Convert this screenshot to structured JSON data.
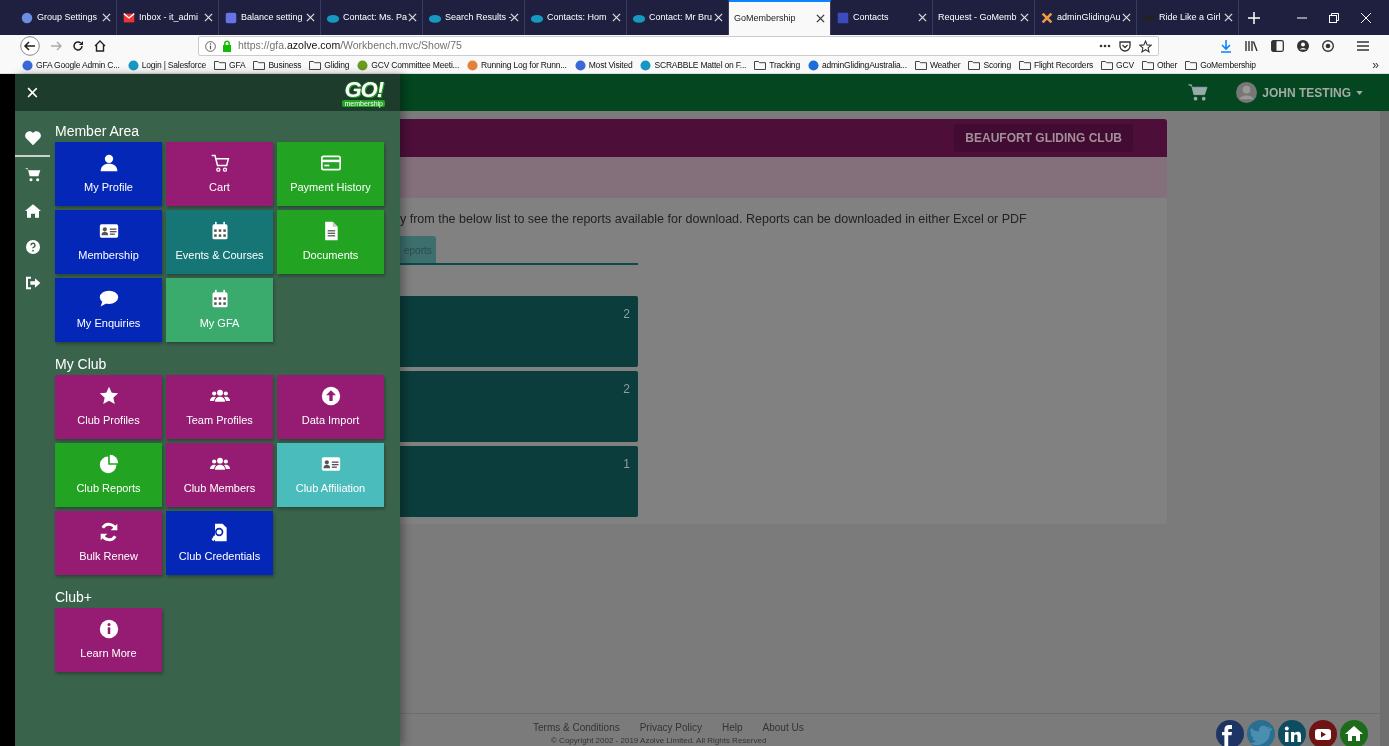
{
  "browser": {
    "tabs": [
      {
        "title": "Group Settings",
        "selected": false
      },
      {
        "title": "Inbox - it_admi",
        "selected": false
      },
      {
        "title": "Balance setting",
        "selected": false
      },
      {
        "title": "Contact: Ms. Pa",
        "selected": false
      },
      {
        "title": "Search Results -",
        "selected": false
      },
      {
        "title": "Contacts: Hom",
        "selected": false
      },
      {
        "title": "Contact: Mr Bru",
        "selected": false
      },
      {
        "title": "GoMembership",
        "selected": true
      },
      {
        "title": "Contacts",
        "selected": false
      },
      {
        "title": "Request - GoMemb",
        "selected": false
      },
      {
        "title": "adminGlidingAu",
        "selected": false
      },
      {
        "title": "Ride Like a Girl",
        "selected": false
      }
    ],
    "url_prefix": "https://gfa.",
    "url_domain": "azolve.com",
    "url_path": "/Workbench.mvc/Show/75",
    "bookmarks": [
      {
        "label": "GFA Google Admin C...",
        "kind": "site"
      },
      {
        "label": "Login | Salesforce",
        "kind": "site"
      },
      {
        "label": "GFA",
        "kind": "folder"
      },
      {
        "label": "Business",
        "kind": "folder"
      },
      {
        "label": "Gliding",
        "kind": "folder"
      },
      {
        "label": "GCV Committee Meeti...",
        "kind": "site"
      },
      {
        "label": "Running Log for Runn...",
        "kind": "site"
      },
      {
        "label": "Most Visited",
        "kind": "site"
      },
      {
        "label": "SCRABBLE Mattel on F...",
        "kind": "site"
      },
      {
        "label": "Tracking",
        "kind": "folder"
      },
      {
        "label": "adminGlidingAustralia...",
        "kind": "site"
      },
      {
        "label": "Weather",
        "kind": "folder"
      },
      {
        "label": "Scoring",
        "kind": "folder"
      },
      {
        "label": "Flight Recorders",
        "kind": "folder"
      },
      {
        "label": "GCV",
        "kind": "folder"
      },
      {
        "label": "Other",
        "kind": "folder"
      },
      {
        "label": "GoMembership",
        "kind": "folder"
      }
    ],
    "overflow": "»"
  },
  "navbar": {
    "user": "JOHN TESTING"
  },
  "card": {
    "club": "BEAUFORT GLIDING CLUB",
    "intro": "y from the below list to see the reports available for download. Reports can be downloaded in either Excel or PDF",
    "tab": "eports",
    "categories": [
      {
        "count": "2"
      },
      {
        "count": "2"
      },
      {
        "count": "1"
      }
    ]
  },
  "footer": {
    "links": [
      "Terms & Conditions",
      "Privacy Policy",
      "Help",
      "About Us"
    ],
    "copyright": "© Copyright 2002 - 2019 Azolve Limited. All Rights Reserved"
  },
  "drawer": {
    "close": "×",
    "logo": {
      "text": "GO!",
      "subtext": "membership"
    },
    "rail": [
      {
        "selected": true
      },
      {
        "selected": false
      },
      {
        "selected": false
      },
      {
        "selected": false
      },
      {
        "selected": false
      }
    ],
    "sections": [
      {
        "title": "Member Area",
        "tiles": [
          {
            "label": "My Profile",
            "color": "#0527b8"
          },
          {
            "label": "Cart",
            "color": "#951c72"
          },
          {
            "label": "Payment History",
            "color": "#22a322"
          },
          {
            "label": "Membership",
            "color": "#0527b8"
          },
          {
            "label": "Events & Courses",
            "color": "#167676"
          },
          {
            "label": "Documents",
            "color": "#22a322"
          },
          {
            "label": "My Enquiries",
            "color": "#0527b8"
          },
          {
            "label": "My GFA",
            "color": "#3aaa6d"
          }
        ]
      },
      {
        "title": "My Club",
        "tiles": [
          {
            "label": "Club Profiles",
            "color": "#951c72"
          },
          {
            "label": "Team Profiles",
            "color": "#951c72"
          },
          {
            "label": "Data Import",
            "color": "#951c72"
          },
          {
            "label": "Club Reports",
            "color": "#22a322"
          },
          {
            "label": "Club Members",
            "color": "#951c72"
          },
          {
            "label": "Club Affiliation",
            "color": "#4bbcbc"
          },
          {
            "label": "Bulk Renew",
            "color": "#951c72"
          },
          {
            "label": "Club Credentials",
            "color": "#0527b8"
          }
        ]
      },
      {
        "title": "Club+",
        "tiles": [
          {
            "label": "Learn More",
            "color": "#951c72"
          }
        ]
      }
    ]
  }
}
